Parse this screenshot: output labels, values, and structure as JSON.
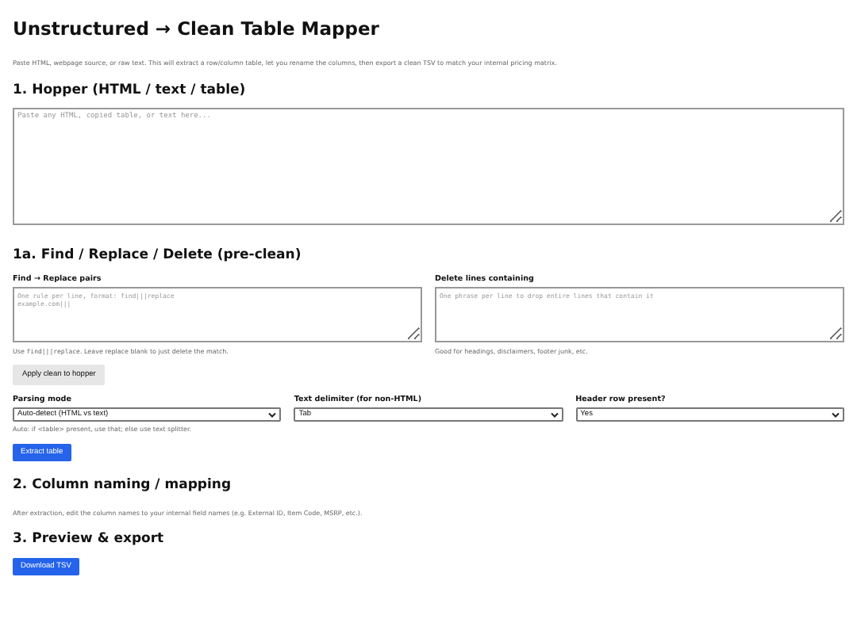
{
  "title": "Unstructured → Clean Table Mapper",
  "description": "Paste HTML, webpage source, or raw text. This will extract a row/column table, let you rename the columns, then export a clean TSV to match your internal pricing matrix.",
  "hopper": {
    "heading": "1. Hopper (HTML / text / table)",
    "placeholder": "Paste any HTML, copied table, or text here..."
  },
  "preclean": {
    "heading": "1a. Find / Replace / Delete (pre-clean)",
    "fields": [
      {
        "label": "Find → Replace pairs",
        "placeholder": "One rule per line, format: find|||replace\nexample.com|||",
        "hint_before": "Use ",
        "hint_code": "find|||replace",
        "hint_after": ". Leave replace blank to just delete the match."
      },
      {
        "label": "Delete lines containing",
        "placeholder": "One phrase per line to drop entire lines that contain it",
        "hint_before": "Good for headings, disclaimers, footer junk, etc."
      }
    ],
    "button": "Apply clean to hopper"
  },
  "parsing": {
    "selects": [
      {
        "label": "Parsing mode",
        "value": "Auto-detect (HTML vs text)"
      },
      {
        "label": "Text delimiter (for non-HTML)",
        "value": "Tab"
      },
      {
        "label": "Header row present?",
        "value": "Yes"
      }
    ],
    "hint": "Auto: if <table> present, use that; else use text splitter.",
    "button": "Extract table"
  },
  "mapping": {
    "heading": "2. Column naming / mapping",
    "hint": "After extraction, edit the column names to your internal field names (e.g. External ID, Item Code, MSRP, etc.)."
  },
  "export": {
    "heading": "3. Preview & export",
    "button": "Download TSV"
  }
}
